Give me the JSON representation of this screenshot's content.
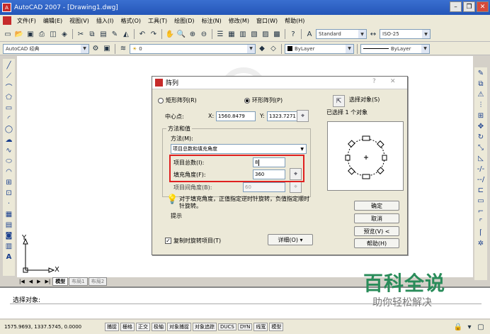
{
  "window": {
    "title": "AutoCAD 2007 - [Drawing1.dwg]",
    "app_icon": "A"
  },
  "menu": [
    "文件(F)",
    "编辑(E)",
    "视图(V)",
    "插入(I)",
    "格式(O)",
    "工具(T)",
    "绘图(D)",
    "标注(N)",
    "修改(M)",
    "窗口(W)",
    "帮助(H)"
  ],
  "toolbar": {
    "text_style": "Standard",
    "dim_style": "ISO-25",
    "workspace": "AutoCAD 经典",
    "layer": "0",
    "color": "ByLayer",
    "linetype": "ByLayer"
  },
  "dialog": {
    "title": "阵列",
    "rect_array_label": "矩形阵列(R)",
    "polar_array_label": "环形阵列(P)",
    "select_objects_label": "选择对象(S)",
    "selected_count_label": "已选择 1 个对象",
    "center_label": "中心点:",
    "x_label": "X:",
    "x_value": "1560.8479",
    "y_label": "Y:",
    "y_value": "1323.7271",
    "method_group_label": "方法和值",
    "method_label": "方法(M):",
    "method_value": "项目总数和填充角度",
    "total_label": "项目总数(I):",
    "total_value": "8",
    "fill_label": "填充角度(F):",
    "fill_value": "360",
    "between_label": "项目间角度(B):",
    "between_value": "60",
    "tip_text": "对于填充角度，正值指定逆时针旋转，负值指定顺时针旋转。",
    "tip_label": "提示",
    "rotate_checkbox": "复制时旋转项目(T)",
    "details_button": "详细(O) ▾",
    "ok_button": "确定",
    "cancel_button": "取消",
    "preview_button": "预览(V) <",
    "help_button": "帮助(H)",
    "close_glyph": "✕",
    "help_glyph": "?"
  },
  "layout_tabs": [
    "模型",
    "布局1",
    "布局2"
  ],
  "ucs": {
    "x": "X",
    "y": "Y"
  },
  "command_prompt": "选择对象:",
  "status_bar": {
    "coords": "1575.9693, 1337.5745, 0.0000",
    "toggles": [
      "捕捉",
      "栅格",
      "正交",
      "极轴",
      "对象捕捉",
      "对象追踪",
      "DUCS",
      "DYN",
      "线宽",
      "模型"
    ]
  },
  "watermark": {
    "title": "百科全说",
    "subtitle": "助你轻松解决"
  },
  "colors": {
    "highlight": "#e02020",
    "title_bar": "#2456b8",
    "watermark": "#2a8c5a"
  }
}
